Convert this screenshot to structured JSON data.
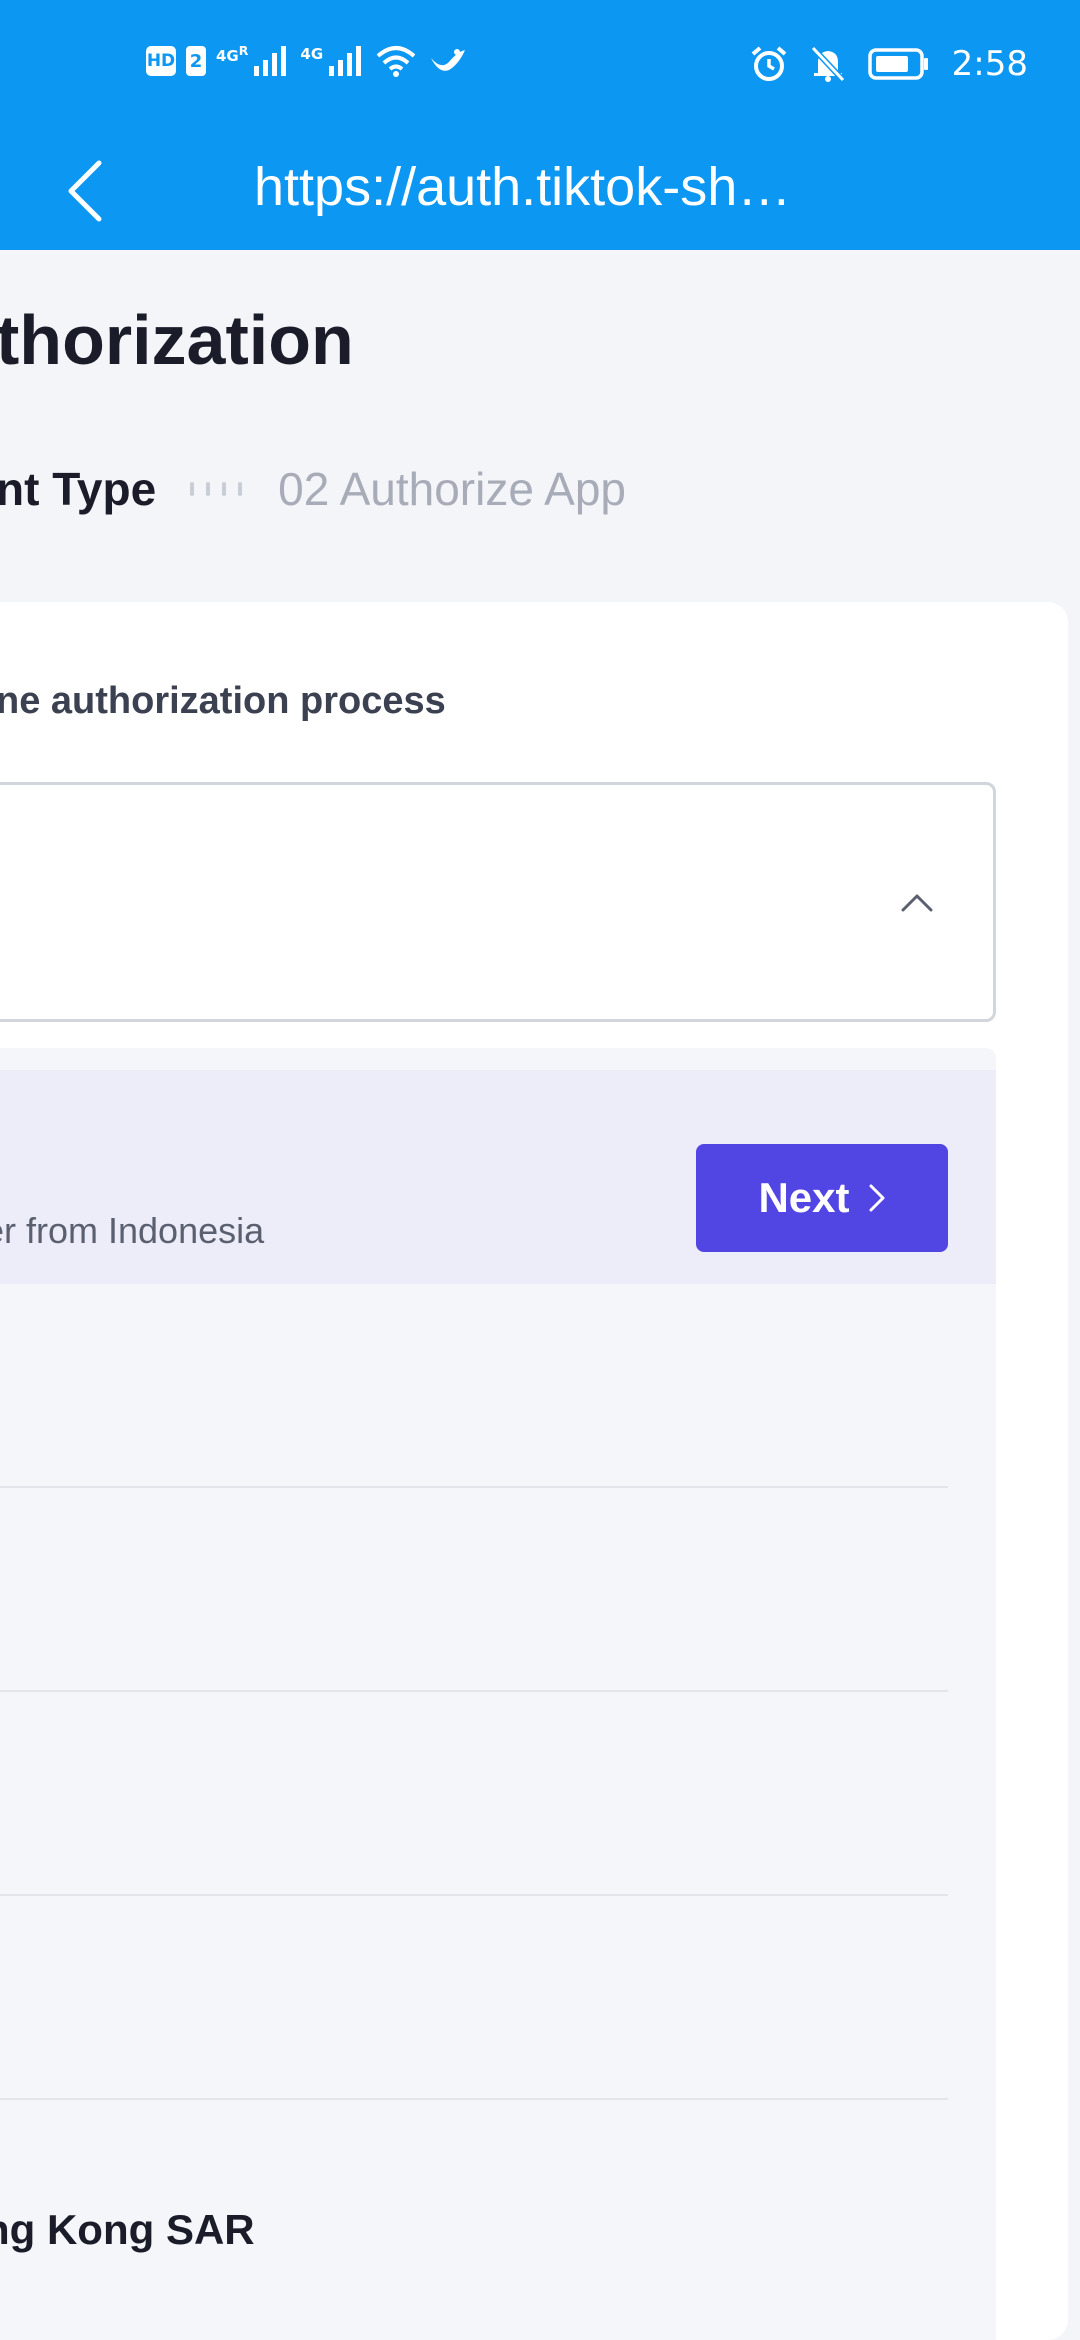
{
  "status_bar": {
    "hd_badge": "HD",
    "sim_badge": "2",
    "net_1": "4G",
    "net_1_sup": "R",
    "net_2": "4G",
    "time": "2:58"
  },
  "app_bar": {
    "url": "https://auth.tiktok-sh…"
  },
  "page": {
    "title": "thorization",
    "step_1": "nt Type",
    "step_2": "02 Authorize App"
  },
  "card": {
    "label": "ne authorization process"
  },
  "list": {
    "selected_subtitle": "er from Indonesia",
    "next_label": "Next",
    "last_row": "ng Kong SAR"
  },
  "colors": {
    "primary_blue": "#0b97f2",
    "button_purple": "#5145e3",
    "selected_row_bg": "#ecedf8"
  }
}
